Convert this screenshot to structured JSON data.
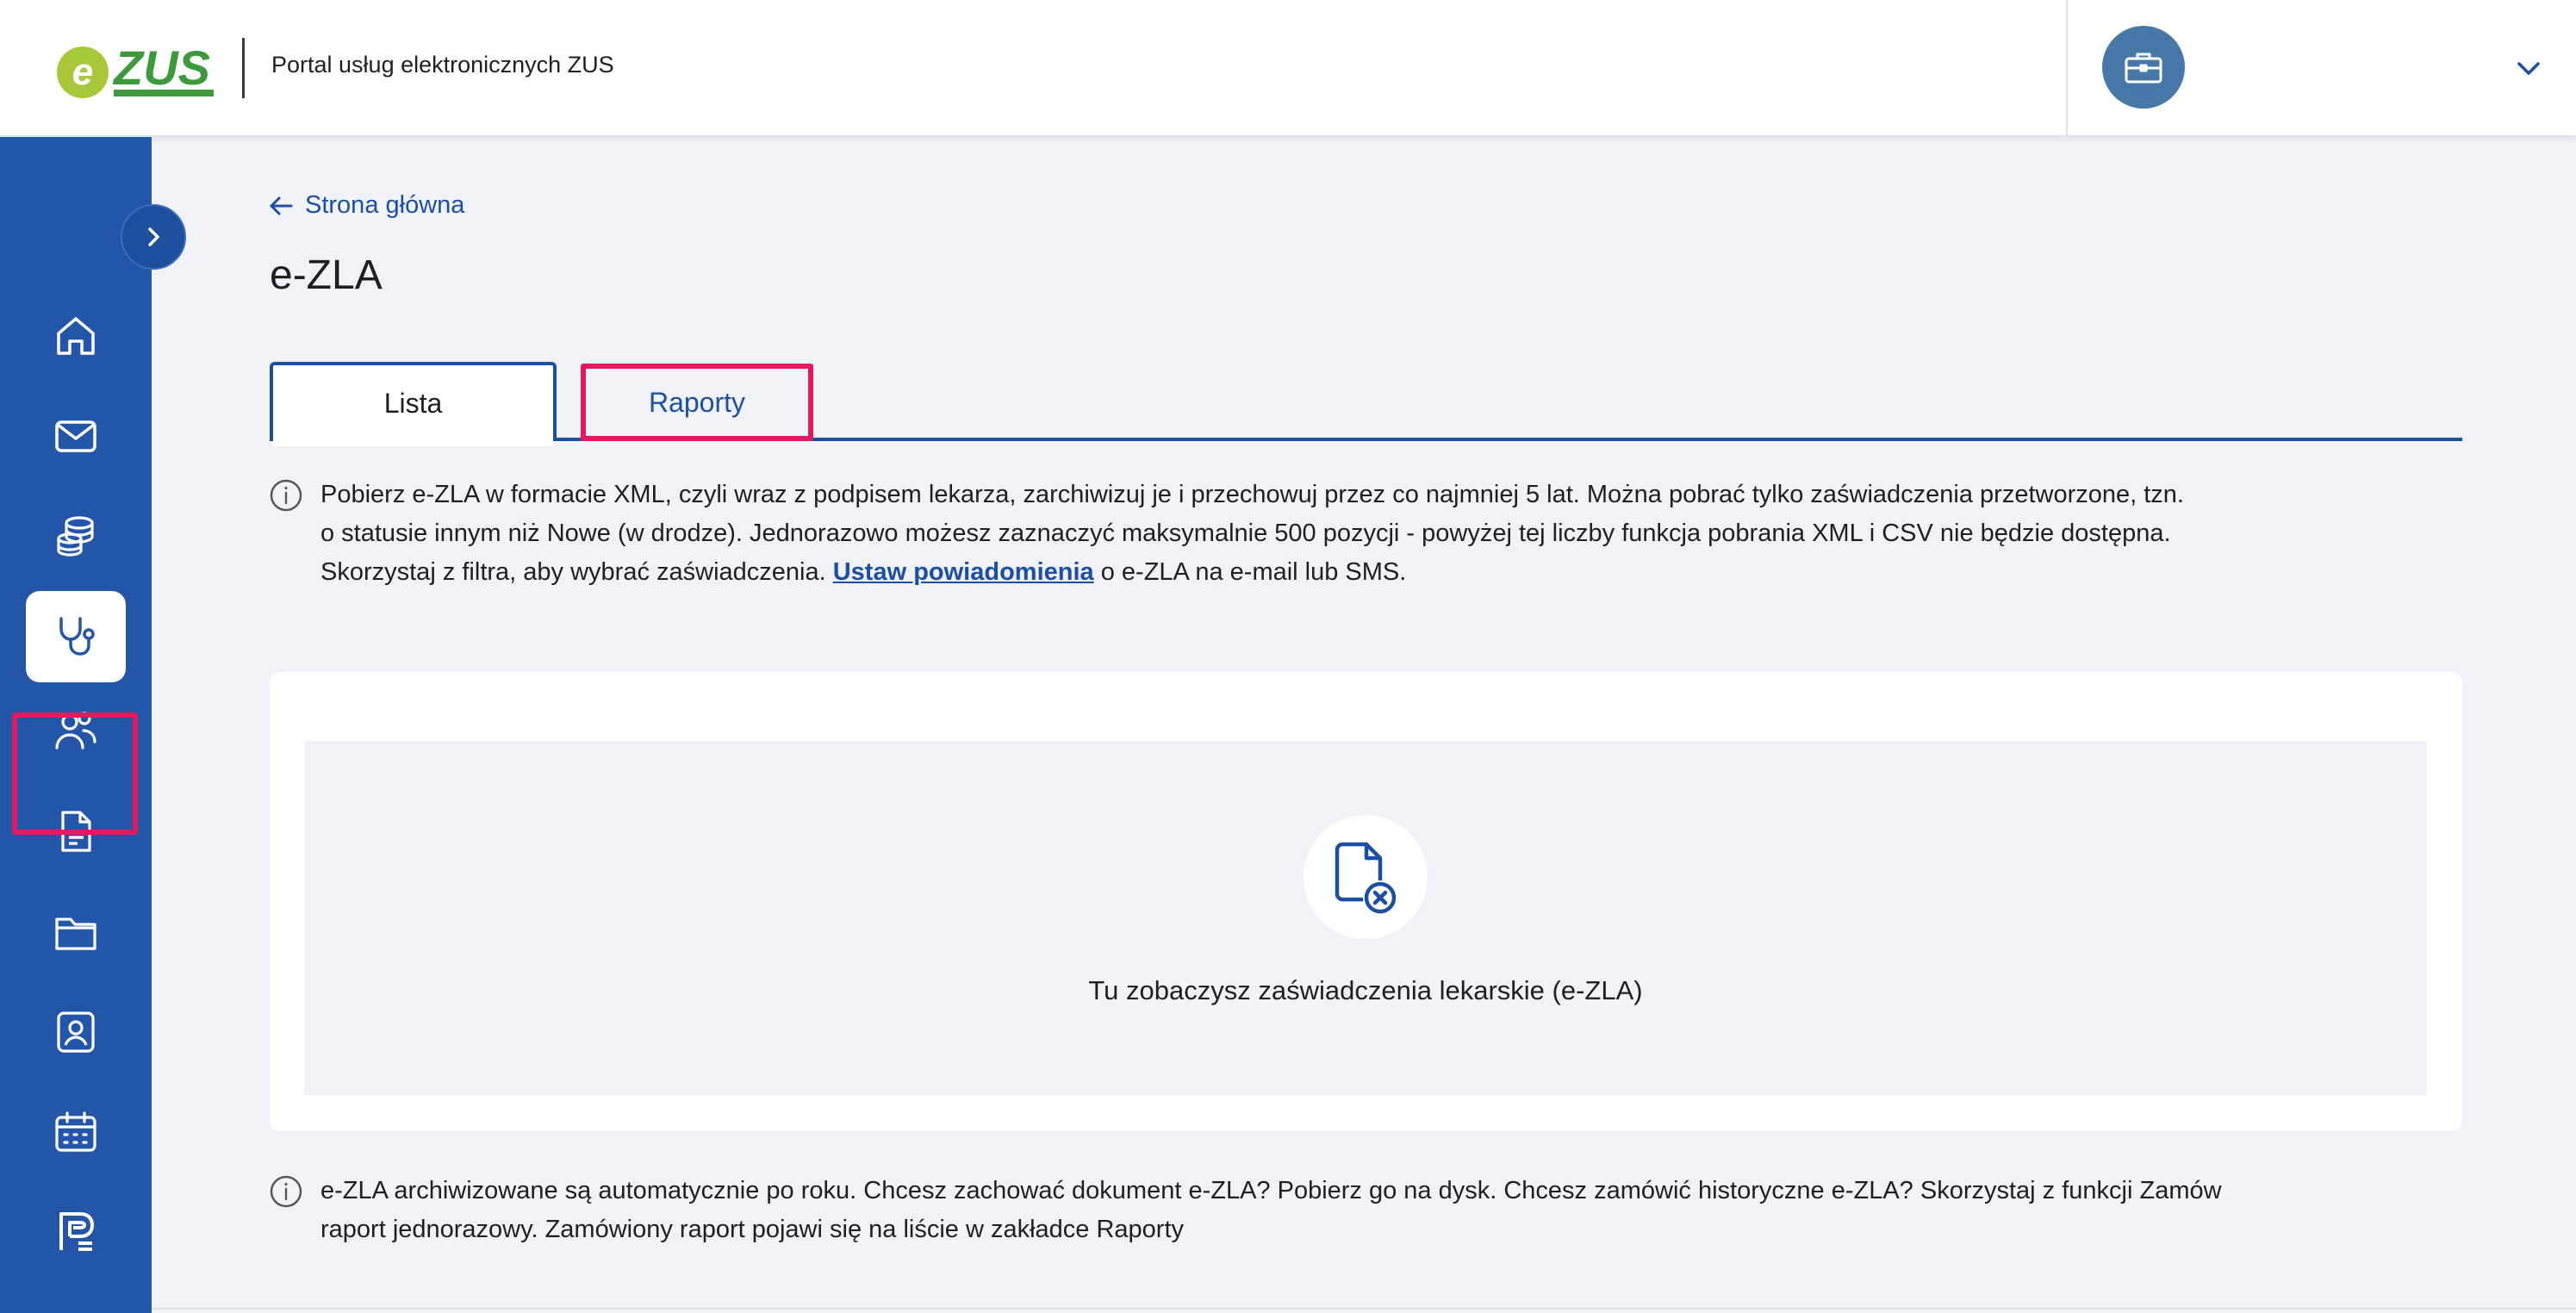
{
  "header": {
    "logo_text": "eZUS",
    "portal_title": "Portal usług elektronicznych ZUS",
    "account_icon": "briefcase-icon",
    "dropdown_icon": "chevron-down-icon"
  },
  "sidebar": {
    "toggle_icon": "chevron-right-icon",
    "items": [
      {
        "icon": "home-icon",
        "active": false
      },
      {
        "icon": "mail-icon",
        "active": false
      },
      {
        "icon": "coins-icon",
        "active": false
      },
      {
        "icon": "stethoscope-icon",
        "active": true
      },
      {
        "icon": "people-icon",
        "active": false
      },
      {
        "icon": "document-icon",
        "active": false
      },
      {
        "icon": "folder-icon",
        "active": false
      },
      {
        "icon": "user-badge-icon",
        "active": false
      },
      {
        "icon": "calendar-icon",
        "active": false
      },
      {
        "icon": "payment-icon",
        "active": false
      }
    ]
  },
  "main": {
    "breadcrumb": "Strona główna",
    "title": "e-ZLA",
    "tabs": [
      {
        "label": "Lista",
        "selected": true
      },
      {
        "label": "Raporty",
        "selected": false
      }
    ],
    "info_top": {
      "line1": "Pobierz e-ZLA w formacie XML, czyli wraz z podpisem lekarza, zarchiwizuj je i przechowuj przez co najmniej 5 lat. Można pobrać tylko zaświadczenia przetworzone, tzn.",
      "line2": "o statusie innym niż Nowe (w drodze). Jednorazowo możesz zaznaczyć maksymalnie 500 pozycji - powyżej tej liczby funkcja pobrania XML i CSV nie będzie dostępna.",
      "line3_before": "Skorzystaj z filtra, aby wybrać zaświadczenia.",
      "link": "Ustaw powiadomienia",
      "line3_after": "o e-ZLA na e-mail lub SMS."
    },
    "empty_state": {
      "icon": "document-remove-icon",
      "text": "Tu zobaczysz zaświadczenia lekarskie (e-ZLA)"
    },
    "info_bottom": {
      "line1": "e-ZLA archiwizowane są automatycznie po roku. Chcesz zachować dokument e-ZLA? Pobierz go na dysk. Chcesz zamówić historyczne e-ZLA? Skorzystaj z funkcji Zamów",
      "line2": "raport jednorazowy. Zamówiony raport pojawi się na liście w zakładce Raporty"
    }
  },
  "colors": {
    "sidebar": "#2356a8",
    "accent": "#1c4fa3",
    "highlight": "#e5195e",
    "logo_green": "#3c9a3c",
    "logo_lime": "#a8c83a",
    "background": "#f0f2f8"
  }
}
